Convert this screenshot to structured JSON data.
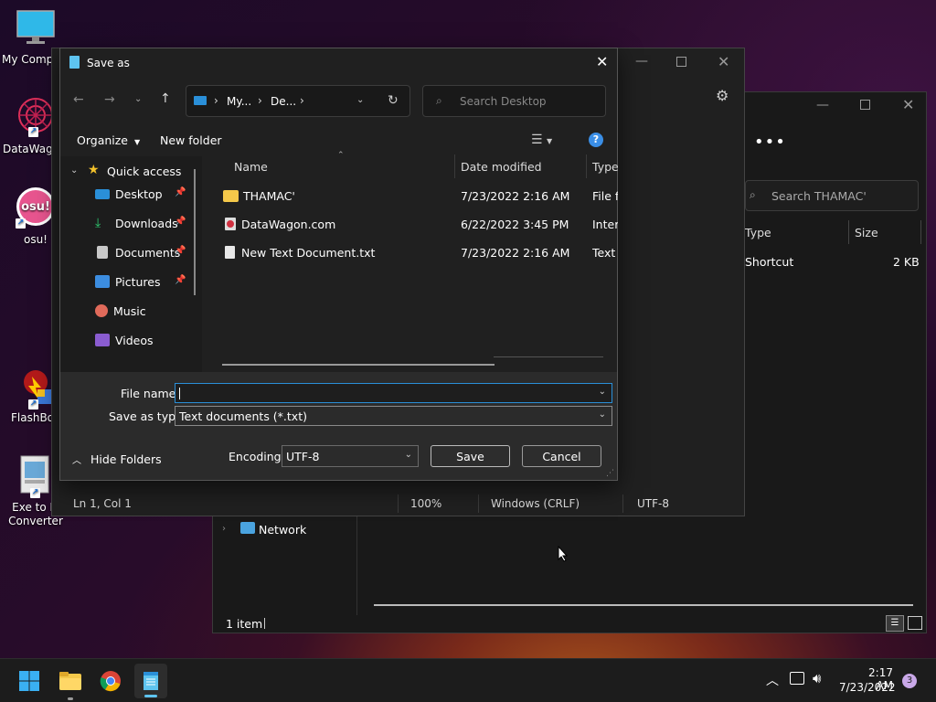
{
  "desktop": {
    "icons": [
      {
        "label": "My Compu"
      },
      {
        "label": "DataWago"
      },
      {
        "label": "osu!"
      },
      {
        "label": "FlashBoo"
      },
      {
        "label": "Exe to M"
      },
      {
        "label": "Converter"
      }
    ],
    "osu_text": "osu!"
  },
  "explorer": {
    "search_placeholder": "Search THAMAC'",
    "col_type": "Type",
    "col_size": "Size",
    "row_type": "Shortcut",
    "row_size": "2 KB",
    "nav_network": "Network",
    "status": "1 item"
  },
  "notepad": {
    "status_pos": "Ln 1, Col 1",
    "status_zoom": "100%",
    "status_eol": "Windows (CRLF)",
    "status_enc": "UTF-8"
  },
  "dialog": {
    "title": "Save as",
    "breadcrumb": [
      "My...",
      "De..."
    ],
    "search_placeholder": "Search Desktop",
    "organize": "Organize",
    "new_folder": "New folder",
    "nav": {
      "quick_access": "Quick access",
      "items": [
        "Desktop",
        "Downloads",
        "Documents",
        "Pictures",
        "Music",
        "Videos"
      ]
    },
    "columns": {
      "name": "Name",
      "date": "Date modified",
      "type": "Type"
    },
    "files": [
      {
        "name": "THAMAC'",
        "date": "7/23/2022 2:16 AM",
        "type": "File fo"
      },
      {
        "name": "DataWagon.com",
        "date": "6/22/2022 3:45 PM",
        "type": "Intern"
      },
      {
        "name": "New Text Document.txt",
        "date": "7/23/2022 2:16 AM",
        "type": "Text D"
      }
    ],
    "file_name_label": "File name:",
    "file_name_value": "",
    "save_type_label": "Save as type:",
    "save_type_value": "Text documents (*.txt)",
    "hide_folders": "Hide Folders",
    "encoding_label": "Encoding:",
    "encoding_value": "UTF-8",
    "save": "Save",
    "cancel": "Cancel"
  },
  "taskbar": {
    "time": "2:17 AM",
    "date": "7/23/2022",
    "notif_count": "3"
  },
  "colors": {
    "accent": "#2a8fd8",
    "help": "#3a8ee6"
  }
}
